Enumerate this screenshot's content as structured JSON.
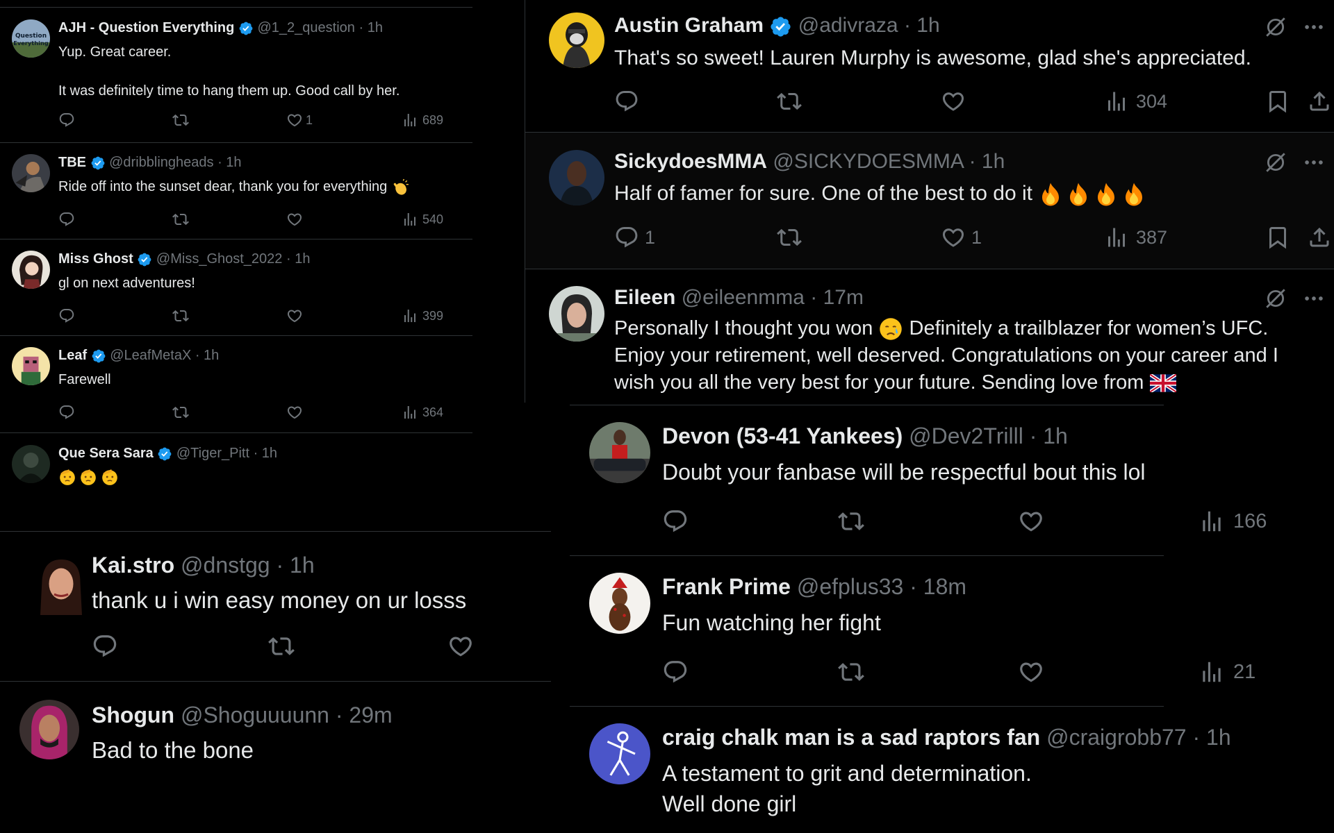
{
  "colors": {
    "background": "#000000",
    "primary_text": "#e7e9ea",
    "secondary_text": "#71767b",
    "verified_badge": "#1d9bf0",
    "divider": "#2f3336"
  },
  "icons": {
    "reply": "reply-icon",
    "repost": "repost-icon",
    "like": "heart-icon",
    "views": "views-icon",
    "bookmark": "bookmark-icon",
    "share": "share-icon",
    "grok": "grok-icon",
    "more": "more-icon",
    "verified": "verified-badge-icon"
  },
  "left_top": [
    {
      "name": "AJH - Question Everything",
      "verified": true,
      "handle": "@1_2_question",
      "time": "· 1h",
      "lines": [
        "Yup. Great career.",
        "",
        "It was definitely time to hang them up. Good call by her."
      ],
      "replies": "",
      "likes": "1",
      "views": "689"
    },
    {
      "name": "TBE",
      "verified": true,
      "handle": "@dribblingheads",
      "time": "· 1h",
      "lines": [
        "Ride off into the sunset dear, thank you for everything"
      ],
      "emojis": [
        "clapping-hands-emoji"
      ],
      "replies": "",
      "likes": "",
      "views": "540"
    },
    {
      "name": "Miss Ghost",
      "verified": true,
      "handle": "@Miss_Ghost_2022",
      "time": "· 1h",
      "lines": [
        "gl on next adventures!"
      ],
      "replies": "",
      "likes": "",
      "views": "399"
    },
    {
      "name": "Leaf",
      "verified": true,
      "handle": "@LeafMetaX",
      "time": "· 1h",
      "lines": [
        "Farewell"
      ],
      "replies": "",
      "likes": "",
      "views": "364"
    },
    {
      "name": "Que Sera Sara",
      "verified": true,
      "handle": "@Tiger_Pitt",
      "time": "· 1h",
      "emojis": [
        "saluting-face-emoji",
        "saluting-face-emoji",
        "saluting-face-emoji"
      ]
    }
  ],
  "left_bottom": [
    {
      "name": "Kai.stro",
      "handle": "@dnstgg",
      "time": "· 1h",
      "text": "thank u i win easy money on ur losss"
    },
    {
      "name": "Shogun",
      "handle": "@Shoguuuunn",
      "time": "· 29m",
      "text": "Bad to the bone"
    }
  ],
  "right_top": [
    {
      "name": "Austin Graham",
      "verified": true,
      "handle": "@adivraza",
      "time": "· 1h",
      "text": "That's so sweet! Lauren Murphy is awesome, glad she's appreciated.",
      "replies": "",
      "likes": "",
      "views": "304"
    },
    {
      "name": "SickydoesMMA",
      "handle": "@SICKYDOESMMA",
      "time": "· 1h",
      "text": "Half of famer for sure. One of the best to do it",
      "emojis": [
        "fire-emoji",
        "fire-emoji",
        "fire-emoji",
        "fire-emoji"
      ],
      "replies": "1",
      "likes": "1",
      "views": "387"
    },
    {
      "name": "Eileen",
      "handle": "@eileenmma",
      "time": "· 17m",
      "line1_before": "Personally I thought you won",
      "line1_emoji": "crying-face-emoji",
      "line1_after": "Definitely a trailblazer for women’s UFC.",
      "line2": "Enjoy your retirement, well deserved. Congratulations on your career and I",
      "line3": "wish you all the very best for your future. Sending love from",
      "line3_emoji": "uk-flag-emoji"
    }
  ],
  "right_bottom": [
    {
      "name": "Devon (53-41 Yankees)",
      "handle": "@Dev2Trilll",
      "time": "· 1h",
      "text": "Doubt your fanbase will be respectful bout this lol",
      "views": "166"
    },
    {
      "name": "Frank Prime",
      "handle": "@efplus33",
      "time": "· 18m",
      "text": "Fun watching her fight",
      "views": "21"
    },
    {
      "name": "craig chalk man is a sad raptors fan",
      "handle": "@craigrobb77",
      "time": "· 1h",
      "lines": [
        "A testament to grit and determination.",
        "Well done girl"
      ]
    }
  ]
}
